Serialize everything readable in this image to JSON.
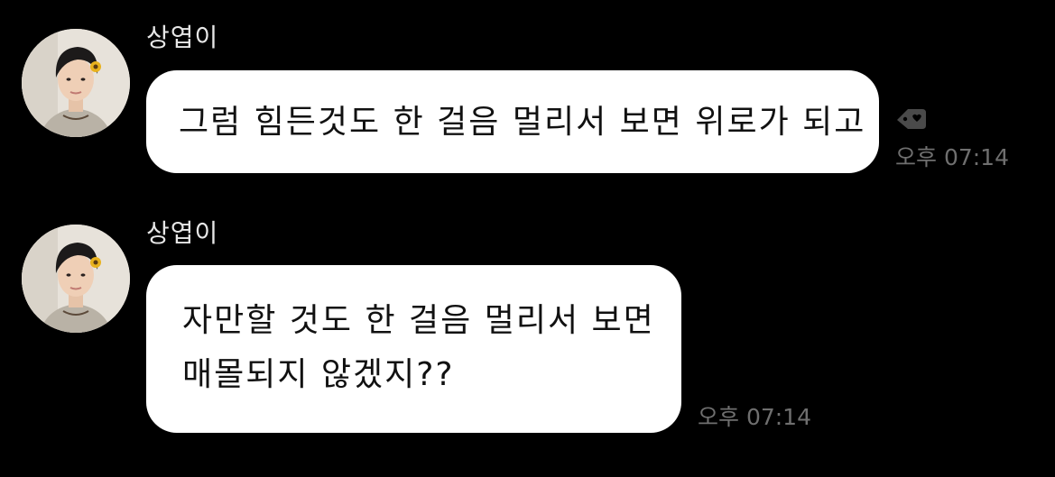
{
  "messages": [
    {
      "sender": "상엽이",
      "lines": [
        "그럼 힘든것도 한 걸음 멀리서 보면 위로가 되고"
      ],
      "time": "오후 07:14",
      "has_reaction_icon": true
    },
    {
      "sender": "상엽이",
      "lines": [
        "자만할 것도 한 걸음 멀리서 보면",
        "매몰되지 않겠지??"
      ],
      "time": "오후 07:14",
      "has_reaction_icon": false
    }
  ],
  "colors": {
    "background": "#000000",
    "bubble": "#ffffff",
    "bubble_text": "#111111",
    "sender_name": "#e6e6e6",
    "timestamp": "#6f6f6f",
    "reaction_icon": "#4a4a4a"
  },
  "icons": {
    "reaction": "heart-tag-icon",
    "avatar": "profile-photo"
  }
}
